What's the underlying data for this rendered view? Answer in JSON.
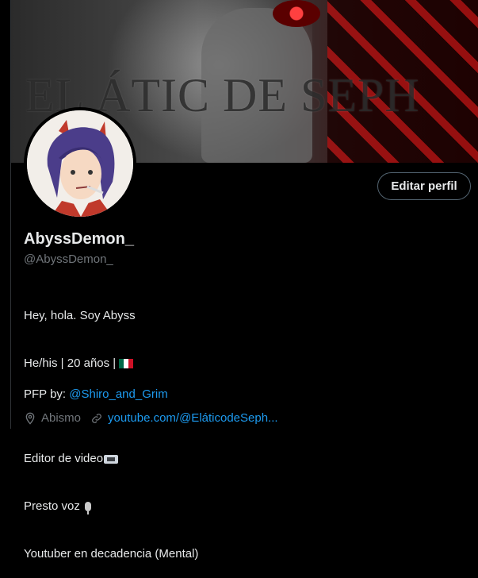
{
  "banner": {
    "text": "EL ÁTIC DE SEPH"
  },
  "profile": {
    "display_name": "AbyssDemon_",
    "handle": "@AbyssDemon_",
    "edit_button_label": "Editar perfil",
    "bio": {
      "line1": "Hey, hola. Soy Abyss",
      "line2": "He/his | 20 años |",
      "line3": "Editor de video",
      "line4": "Presto voz",
      "line5": "Youtuber en decadencia (Mental)"
    },
    "pfp_prefix": "PFP by: ",
    "pfp_mention": "@Shiro_and_Grim",
    "location": "Abismo",
    "website": "youtube.com/@EláticodeSeph..."
  },
  "colors": {
    "background": "#000000",
    "text": "#e7e9ea",
    "secondary_text": "#71767b",
    "link": "#1d9bf0",
    "border": "#536471"
  },
  "icons": {
    "location": "location-pin-icon",
    "link": "link-icon",
    "flag": "mexico-flag-icon",
    "video": "videocassette-icon",
    "mic": "microphone-icon"
  }
}
